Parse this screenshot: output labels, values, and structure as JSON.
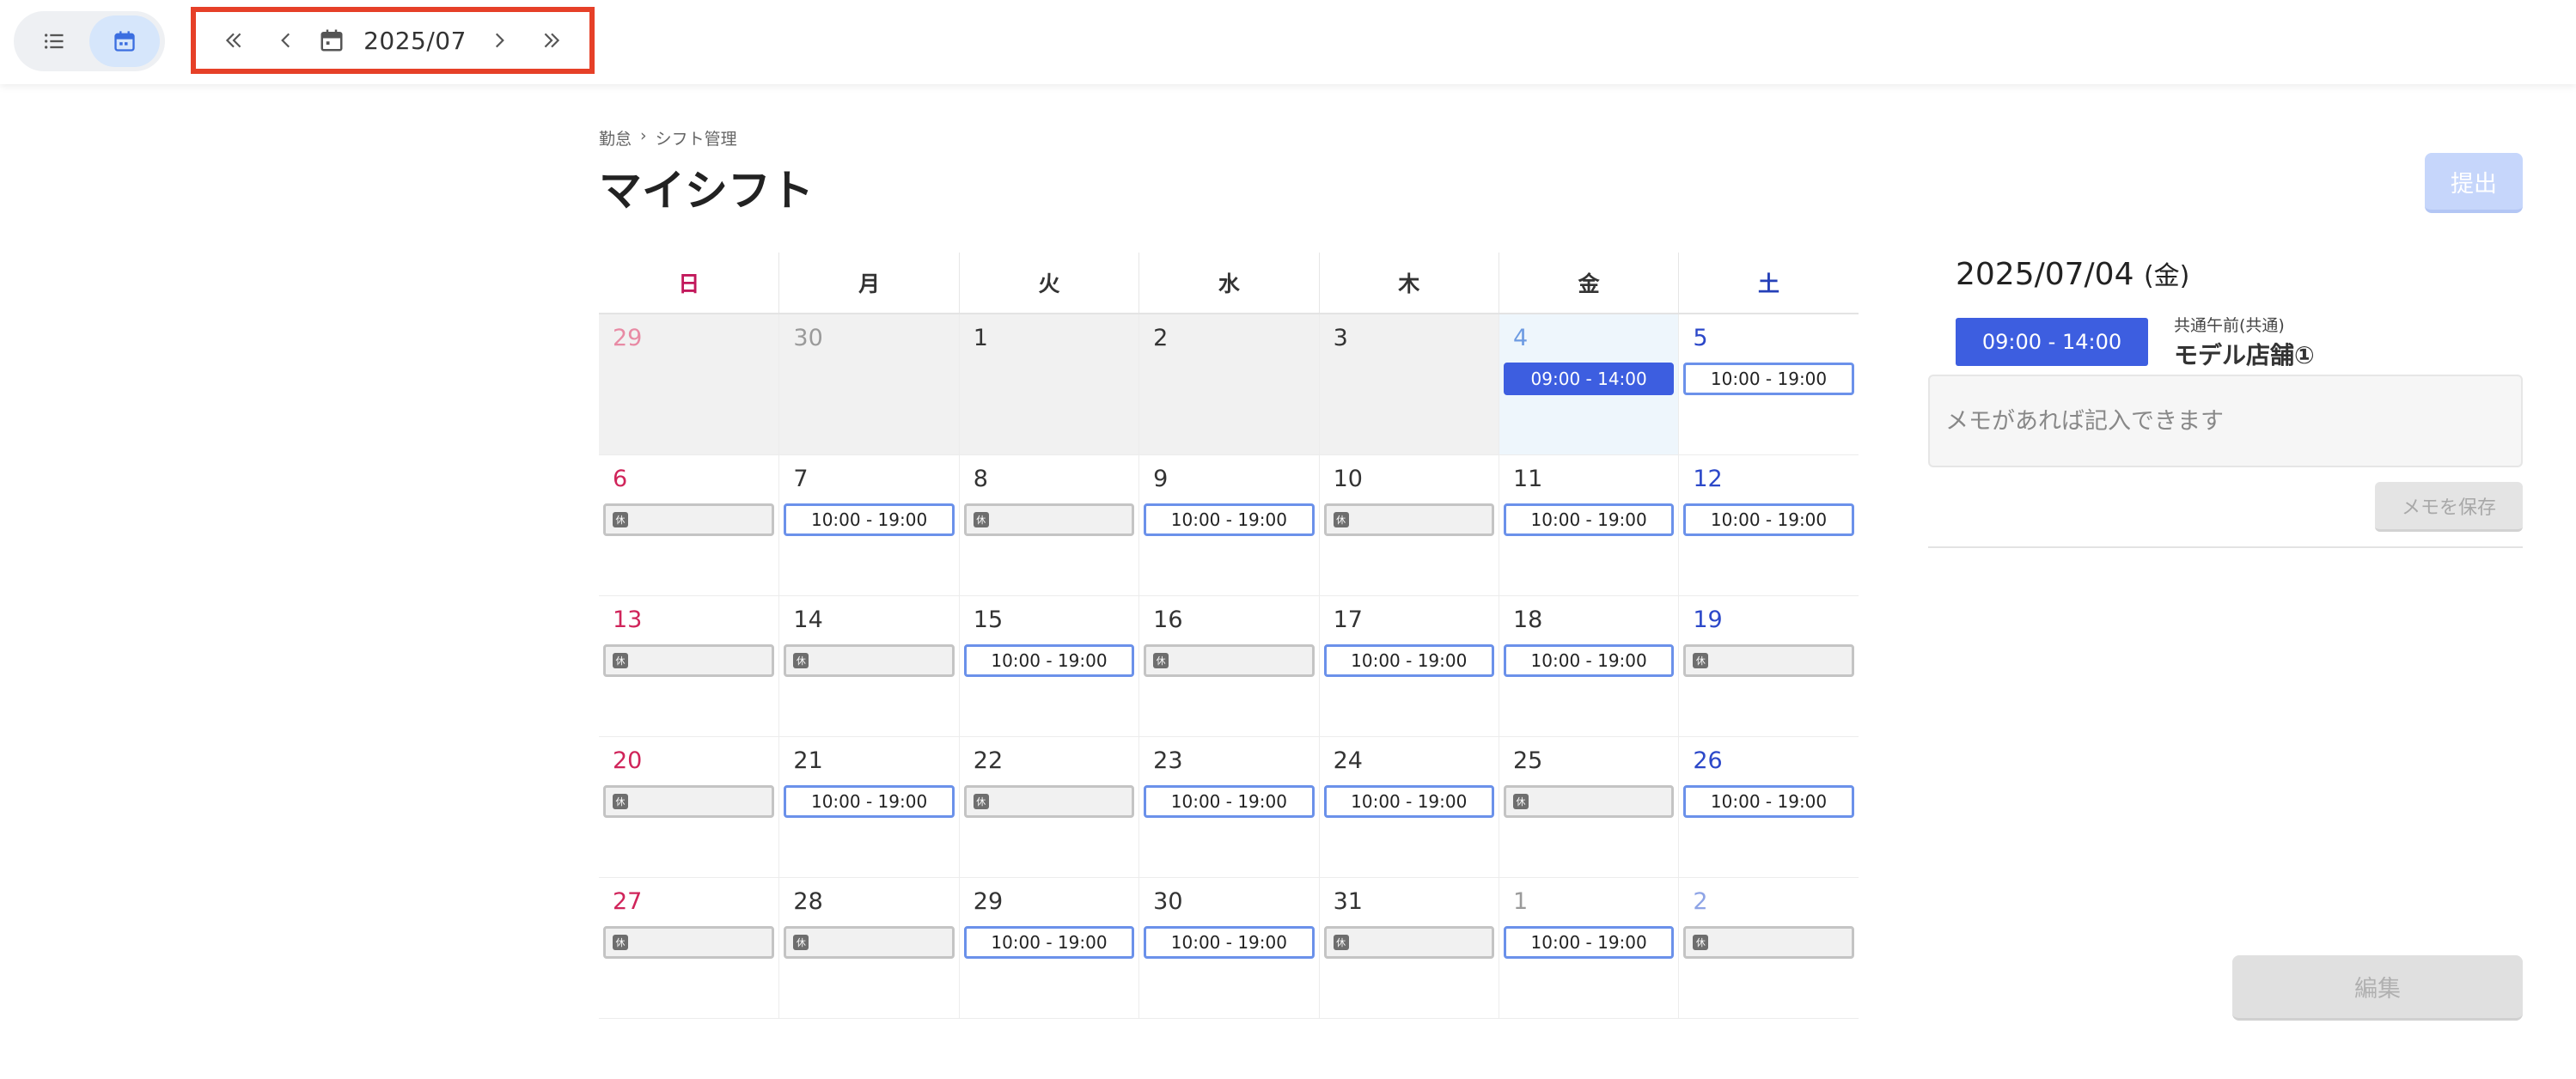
{
  "toolbar": {
    "views": [
      {
        "name": "list-view",
        "icon": "list-icon",
        "active": false
      },
      {
        "name": "calendar-view",
        "icon": "calendar-icon",
        "active": true
      }
    ],
    "month": "2025/07",
    "icons": {
      "first": "double-chevron-left-icon",
      "prev": "chevron-left-icon",
      "calendar": "calendar-icon",
      "next": "chevron-right-icon",
      "last": "double-chevron-right-icon"
    },
    "highlight_color": "#e64028"
  },
  "breadcrumb": {
    "root": "勤怠",
    "separator": "›",
    "current": "シフト管理"
  },
  "page_title": "マイシフト",
  "submit_label": "提出",
  "calendar": {
    "weekdays": [
      "日",
      "月",
      "火",
      "水",
      "木",
      "金",
      "土"
    ],
    "weeks": [
      [
        {
          "day": "29",
          "out": true,
          "past": true
        },
        {
          "day": "30",
          "out": true,
          "past": true
        },
        {
          "day": "1",
          "past": true
        },
        {
          "day": "2",
          "past": true
        },
        {
          "day": "3",
          "past": true
        },
        {
          "day": "4",
          "selected": true,
          "shift": {
            "type": "work",
            "label": "09:00 - 14:00"
          }
        },
        {
          "day": "5",
          "shift": {
            "type": "work",
            "label": "10:00 - 19:00"
          }
        }
      ],
      [
        {
          "day": "6",
          "shift": {
            "type": "off",
            "label": "休"
          }
        },
        {
          "day": "7",
          "shift": {
            "type": "work",
            "label": "10:00 - 19:00"
          }
        },
        {
          "day": "8",
          "shift": {
            "type": "off",
            "label": "休"
          }
        },
        {
          "day": "9",
          "shift": {
            "type": "work",
            "label": "10:00 - 19:00"
          }
        },
        {
          "day": "10",
          "shift": {
            "type": "off",
            "label": "休"
          }
        },
        {
          "day": "11",
          "shift": {
            "type": "work",
            "label": "10:00 - 19:00"
          }
        },
        {
          "day": "12",
          "shift": {
            "type": "work",
            "label": "10:00 - 19:00"
          }
        }
      ],
      [
        {
          "day": "13",
          "shift": {
            "type": "off",
            "label": "休"
          }
        },
        {
          "day": "14",
          "shift": {
            "type": "off",
            "label": "休"
          }
        },
        {
          "day": "15",
          "shift": {
            "type": "work",
            "label": "10:00 - 19:00"
          }
        },
        {
          "day": "16",
          "shift": {
            "type": "off",
            "label": "休"
          }
        },
        {
          "day": "17",
          "shift": {
            "type": "work",
            "label": "10:00 - 19:00"
          }
        },
        {
          "day": "18",
          "shift": {
            "type": "work",
            "label": "10:00 - 19:00"
          }
        },
        {
          "day": "19",
          "shift": {
            "type": "off",
            "label": "休"
          }
        }
      ],
      [
        {
          "day": "20",
          "shift": {
            "type": "off",
            "label": "休"
          }
        },
        {
          "day": "21",
          "shift": {
            "type": "work",
            "label": "10:00 - 19:00"
          }
        },
        {
          "day": "22",
          "shift": {
            "type": "off",
            "label": "休"
          }
        },
        {
          "day": "23",
          "shift": {
            "type": "work",
            "label": "10:00 - 19:00"
          }
        },
        {
          "day": "24",
          "shift": {
            "type": "work",
            "label": "10:00 - 19:00"
          }
        },
        {
          "day": "25",
          "shift": {
            "type": "off",
            "label": "休"
          }
        },
        {
          "day": "26",
          "shift": {
            "type": "work",
            "label": "10:00 - 19:00"
          }
        }
      ],
      [
        {
          "day": "27",
          "shift": {
            "type": "off",
            "label": "休"
          }
        },
        {
          "day": "28",
          "shift": {
            "type": "off",
            "label": "休"
          }
        },
        {
          "day": "29",
          "shift": {
            "type": "work",
            "label": "10:00 - 19:00"
          }
        },
        {
          "day": "30",
          "shift": {
            "type": "work",
            "label": "10:00 - 19:00"
          }
        },
        {
          "day": "31",
          "shift": {
            "type": "off",
            "label": "休"
          }
        },
        {
          "day": "1",
          "out": true,
          "shift": {
            "type": "work",
            "label": "10:00 - 19:00"
          }
        },
        {
          "day": "2",
          "out": true,
          "shift": {
            "type": "off",
            "label": "休"
          }
        }
      ]
    ]
  },
  "detail": {
    "date": "2025/07/04",
    "weekday": "(金)",
    "shift_time": "09:00 - 14:00",
    "shift_type": "共通午前(共通)",
    "store": "モデル店舗①",
    "memo_value": "",
    "memo_placeholder": "メモがあれば記入できます",
    "memo_save_label": "メモを保存",
    "edit_label": "編集"
  },
  "colors": {
    "accent": "#3d5ee0",
    "work_border": "#6b91ea",
    "sunday": "#d0245a",
    "saturday": "#2c48c9",
    "submit_disabled": "#c6d6fb"
  }
}
